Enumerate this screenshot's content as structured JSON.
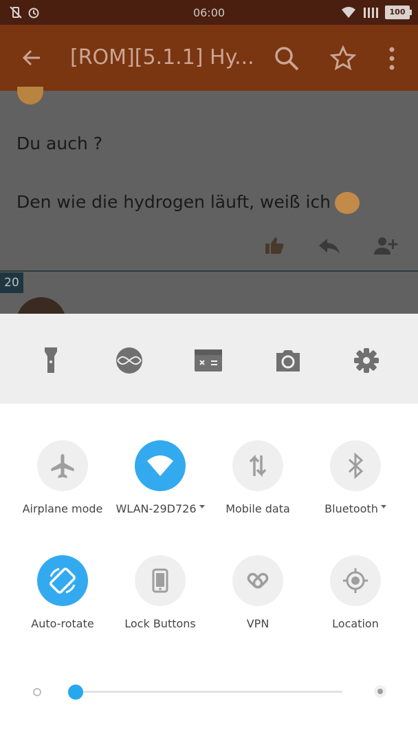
{
  "status_bar": {
    "time": "06:00",
    "battery": "100"
  },
  "app_bar": {
    "title": "[ROM][5.1.1] Hy..."
  },
  "post": {
    "line1": "Du auch ?",
    "line2": "Den wie die hydrogen läuft, weiß ich",
    "post_number": "20"
  },
  "quick_settings": {
    "shortcuts": [
      "flashlight-icon",
      "sound-wave-icon",
      "calculator-icon",
      "camera-icon",
      "gear-icon"
    ],
    "tiles": [
      {
        "label": "Airplane mode",
        "icon": "airplane-icon",
        "active": false,
        "dropdown": false
      },
      {
        "label": "WLAN-29D726",
        "icon": "wifi-icon",
        "active": true,
        "dropdown": true
      },
      {
        "label": "Mobile data",
        "icon": "mobile-data-icon",
        "active": false,
        "dropdown": false
      },
      {
        "label": "Bluetooth",
        "icon": "bluetooth-icon",
        "active": false,
        "dropdown": true
      },
      {
        "label": "Auto-rotate",
        "icon": "auto-rotate-icon",
        "active": true,
        "dropdown": false
      },
      {
        "label": "Lock Buttons",
        "icon": "phone-icon",
        "active": false,
        "dropdown": false
      },
      {
        "label": "VPN",
        "icon": "vpn-icon",
        "active": false,
        "dropdown": false
      },
      {
        "label": "Location",
        "icon": "location-icon",
        "active": false,
        "dropdown": false
      }
    ],
    "brightness_level": 0.03
  },
  "colors": {
    "accent": "#33aaef",
    "app_bar": "#7a3511"
  }
}
